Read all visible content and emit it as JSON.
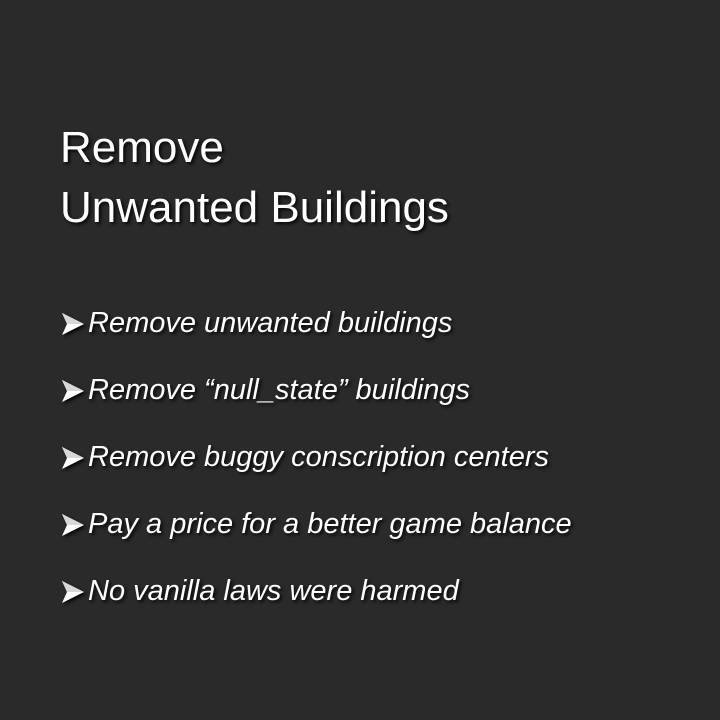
{
  "title": {
    "line1": "Remove",
    "line2": "Unwanted Buildings"
  },
  "bullets": [
    {
      "icon": "arrow-bullet-icon",
      "text": "Remove unwanted buildings"
    },
    {
      "icon": "arrow-bullet-icon",
      "text": "Remove “null_state” buildings"
    },
    {
      "icon": "arrow-bullet-icon",
      "text": "Remove buggy conscription centers"
    },
    {
      "icon": "arrow-bullet-icon",
      "text": "Pay a price for a better game balance"
    },
    {
      "icon": "arrow-bullet-icon",
      "text": "No vanilla laws were harmed"
    }
  ],
  "colors": {
    "background": "#2a2a2a",
    "text": "#ffffff"
  }
}
